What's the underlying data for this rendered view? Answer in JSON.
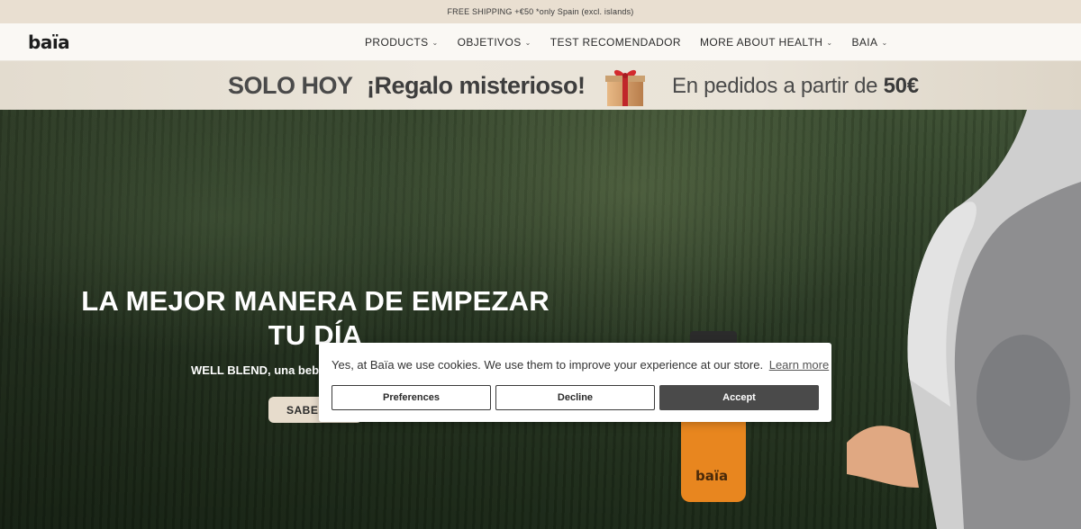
{
  "announcement": {
    "text": "FREE SHIPPING +€50 *only Spain (excl. islands)"
  },
  "header": {
    "logo": "baïa",
    "nav": [
      {
        "label": "PRODUCTS",
        "has_dropdown": true
      },
      {
        "label": "OBJETIVOS",
        "has_dropdown": true
      },
      {
        "label": "TEST RECOMENDADOR",
        "has_dropdown": false
      },
      {
        "label": "MORE ABOUT HEALTH",
        "has_dropdown": true
      },
      {
        "label": "BAIA",
        "has_dropdown": true
      }
    ]
  },
  "promo": {
    "solo": "SOLO HOY",
    "regalo": "¡Regalo misterioso!",
    "pedidos": "En pedidos a partir de",
    "amount": "50€",
    "icon": "gift-icon"
  },
  "hero": {
    "title": "LA MEJOR MANERA DE EMPEZAR TU DÍA",
    "subtitle": "WELL BLEND, una bebida",
    "cta": "SABER",
    "bottle_label": "baïa"
  },
  "cookie": {
    "message": "Yes, at Baïa we use cookies. We use them to improve your experience at our store.",
    "learn_more": "Learn more",
    "preferences": "Preferences",
    "decline": "Decline",
    "accept": "Accept"
  },
  "colors": {
    "announcement_bg": "#e9dfd1",
    "header_bg": "#faf8f4",
    "cta_bg": "#e7dccc",
    "accept_bg": "#4a4a4a"
  }
}
